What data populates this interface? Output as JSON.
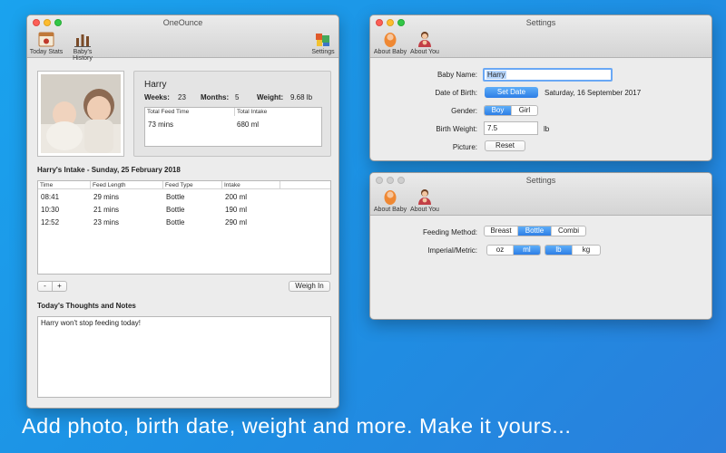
{
  "main_window": {
    "title": "OneOunce",
    "toolbar": {
      "today_stats": "Today Stats",
      "babys_history": "Baby's History",
      "settings": "Settings"
    },
    "baby": {
      "name": "Harry",
      "weeks_label": "Weeks:",
      "weeks": "23",
      "months_label": "Months:",
      "months": "5",
      "weight_label": "Weight:",
      "weight": "9.68 lb",
      "summary_headers": [
        "Total Feed Time",
        "Total Intake"
      ],
      "total_feed_time": "73 mins",
      "total_intake": "680 ml"
    },
    "intake_title": "Harry's Intake - Sunday, 25 February 2018",
    "table": {
      "headers": [
        "Time",
        "Feed Length",
        "Feed Type",
        "Intake"
      ],
      "rows": [
        [
          "08:41",
          "29 mins",
          "Bottle",
          "200 ml"
        ],
        [
          "10:30",
          "21 mins",
          "Bottle",
          "190 ml"
        ],
        [
          "12:52",
          "23 mins",
          "Bottle",
          "290 ml"
        ]
      ]
    },
    "minus_label": "-",
    "plus_label": "+",
    "weigh_in": "Weigh In",
    "notes_title": "Today's Thoughts and Notes",
    "notes_text": "Harry won't stop feeding today!"
  },
  "settings_baby": {
    "title": "Settings",
    "toolbar": {
      "about_baby": "About Baby",
      "about_you": "About You"
    },
    "labels": {
      "name": "Baby Name:",
      "dob": "Date of Birth:",
      "gender": "Gender:",
      "birth_weight": "Birth Weight:",
      "picture": "Picture:"
    },
    "name_value": "Harry",
    "set_date": "Set Date",
    "dob_value": "Saturday, 16 September 2017",
    "gender_options": [
      "Boy",
      "Girl"
    ],
    "gender_selected": "Boy",
    "birth_weight_value": "7.5",
    "birth_weight_unit": "lb",
    "reset": "Reset"
  },
  "settings_you": {
    "title": "Settings",
    "toolbar": {
      "about_baby": "About Baby",
      "about_you": "About You"
    },
    "labels": {
      "feeding": "Feeding Method:",
      "units": "Imperial/Metric:"
    },
    "feeding_options": [
      "Breast",
      "Bottle",
      "Combi"
    ],
    "feeding_selected": "Bottle",
    "volume_options": [
      "oz",
      "ml"
    ],
    "volume_selected": "ml",
    "weight_options": [
      "lb",
      "kg"
    ],
    "weight_selected": "lb"
  },
  "tagline": "Add photo, birth date, weight and more. Make it yours...",
  "colors": {
    "background": "#1e8fe3",
    "selected": "#2d7ee6",
    "close": "#fc5f57",
    "minimize": "#fdbc2e",
    "zoom": "#33c748"
  },
  "icons": [
    "calendar-icon",
    "history-bars-icon",
    "settings-blocks-icon",
    "baby-icon",
    "parent-icon"
  ]
}
